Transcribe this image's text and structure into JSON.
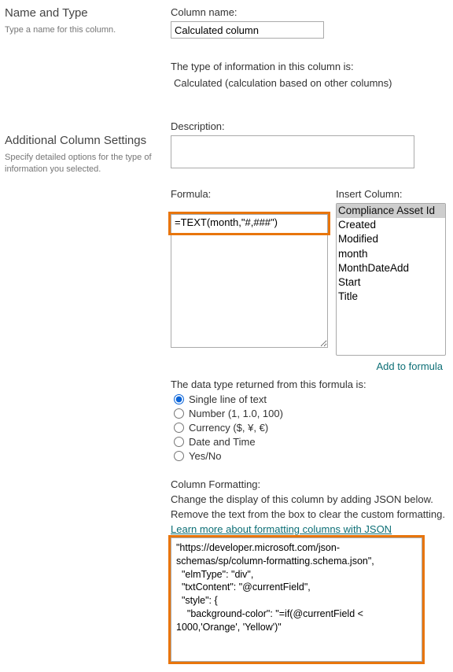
{
  "left": {
    "section1": {
      "heading": "Name and Type",
      "help": "Type a name for this column."
    },
    "section2": {
      "heading": "Additional Column Settings",
      "help": "Specify detailed options for the type of information you selected."
    }
  },
  "columnName": {
    "label": "Column name:",
    "value": "Calculated column"
  },
  "typeInfo": {
    "label": "The type of information in this column is:",
    "value": "Calculated (calculation based on other columns)"
  },
  "description": {
    "label": "Description:",
    "value": ""
  },
  "formula": {
    "label": "Formula:",
    "value": "=TEXT(month,\"#,###\")"
  },
  "insertColumn": {
    "label": "Insert Column:",
    "items": [
      "Compliance Asset Id",
      "Created",
      "Modified",
      "month",
      "MonthDateAdd",
      "Start",
      "Title"
    ],
    "addLink": "Add to formula"
  },
  "returnType": {
    "label": "The data type returned from this formula is:",
    "options": {
      "text": "Single line of text",
      "number": "Number (1, 1.0, 100)",
      "currency": "Currency ($, ¥, €)",
      "datetime": "Date and Time",
      "yesno": "Yes/No"
    }
  },
  "columnFormatting": {
    "heading": "Column Formatting:",
    "line1": "Change the display of this column by adding JSON below.",
    "line2": "Remove the text from the box to clear the custom formatting.",
    "link": "Learn more about formatting columns with JSON",
    "json": "\"https://developer.microsoft.com/json-schemas/sp/column-formatting.schema.json\",\n  \"elmType\": \"div\",\n  \"txtContent\": \"@currentField\",\n  \"style\": {\n    \"background-color\": \"=if(@currentField < 1000,'Orange', 'Yellow')\""
  }
}
